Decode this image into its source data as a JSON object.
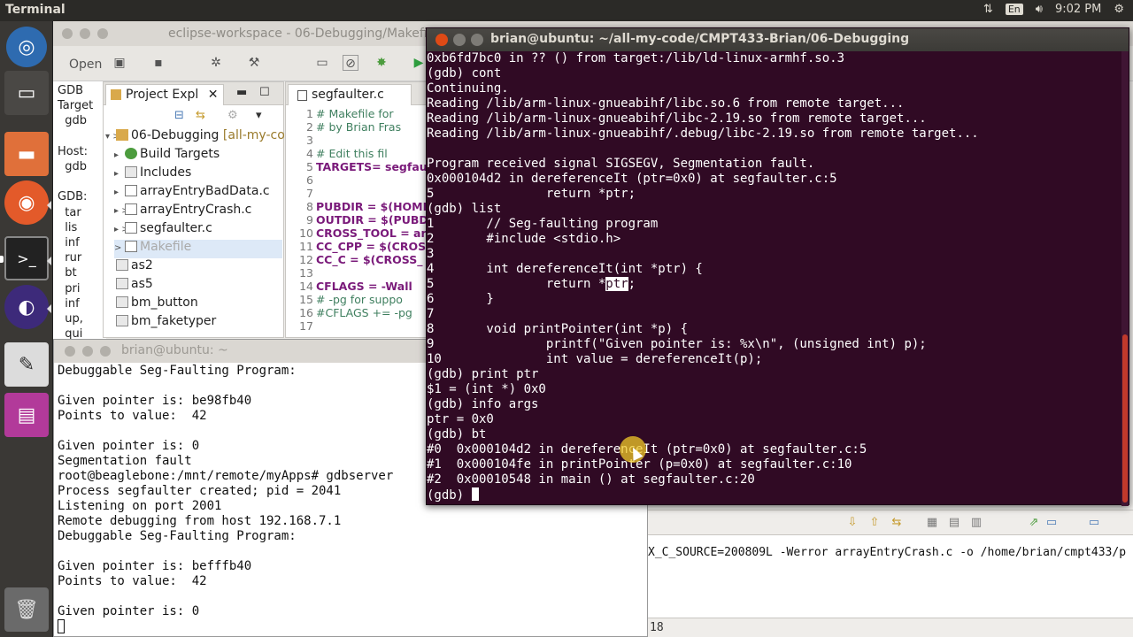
{
  "top_panel": {
    "app_title": "Terminal",
    "lang": "En",
    "time": "9:02 PM"
  },
  "eclipse": {
    "title": "eclipse-workspace - 06-Debugging/Makefi",
    "menu_open": "Open",
    "gdb_lines": [
      "GDB",
      "Target",
      "  gdb",
      "",
      "Host:",
      "  gdb",
      "",
      "GDB:",
      "  tar",
      "  lis",
      "  inf",
      "  rur",
      "  bt",
      "  pri",
      "  inf",
      "  up,",
      "  qui"
    ],
    "project_explorer": {
      "tab_label": "Project Expl",
      "items": [
        {
          "label": "06-Debugging",
          "suffix": "[all-my-co",
          "arrow": "▾ >",
          "icon": "proj",
          "indent": 0
        },
        {
          "label": "Build Targets",
          "arrow": "▸",
          "icon": "green",
          "indent": 1
        },
        {
          "label": "Includes",
          "arrow": "▸",
          "icon": "folder",
          "indent": 1
        },
        {
          "label": "arrayEntryBadData.c",
          "arrow": "▸",
          "icon": "file",
          "indent": 1
        },
        {
          "label": "arrayEntryCrash.c",
          "arrow": "▸ >",
          "icon": "file",
          "indent": 1
        },
        {
          "label": "segfaulter.c",
          "arrow": "▸ >",
          "icon": "file",
          "indent": 1
        },
        {
          "label": "Makefile",
          "arrow": " >",
          "icon": "file",
          "indent": 1,
          "selected": true
        },
        {
          "label": "as2",
          "arrow": "",
          "icon": "folder",
          "indent": 0
        },
        {
          "label": "as5",
          "arrow": "",
          "icon": "folder",
          "indent": 0
        },
        {
          "label": "bm_button",
          "arrow": "",
          "icon": "folder",
          "indent": 0
        },
        {
          "label": "bm_faketyper",
          "arrow": "",
          "icon": "folder",
          "indent": 0
        }
      ]
    },
    "editor": {
      "tab_label": "segfaulter.c",
      "lines": [
        {
          "n": "1",
          "text": "# Makefile for",
          "cls": "c-comment"
        },
        {
          "n": "2",
          "text": "# by Brian Fras",
          "cls": "c-comment"
        },
        {
          "n": "3",
          "text": "",
          "cls": ""
        },
        {
          "n": "4",
          "text": "# Edit this fil",
          "cls": "c-comment"
        },
        {
          "n": "5",
          "text": "TARGETS= segfau",
          "cls": "c-var"
        },
        {
          "n": "6",
          "text": "",
          "cls": ""
        },
        {
          "n": "7",
          "text": "",
          "cls": ""
        },
        {
          "n": "8",
          "text": "PUBDIR = $(HOME",
          "cls": "c-var"
        },
        {
          "n": "9",
          "text": "OUTDIR = $(PUBD",
          "cls": "c-var"
        },
        {
          "n": "10",
          "text": "CROSS_TOOL = ar",
          "cls": "c-var"
        },
        {
          "n": "11",
          "text": "CC_CPP = $(CROS",
          "cls": "c-var"
        },
        {
          "n": "12",
          "text": "CC_C = $(CROSS_",
          "cls": "c-var"
        },
        {
          "n": "13",
          "text": "",
          "cls": ""
        },
        {
          "n": "14",
          "text": "CFLAGS = -Wall",
          "cls": "c-var"
        },
        {
          "n": "15",
          "text": "# -pg for suppo",
          "cls": "c-comment"
        },
        {
          "n": "16",
          "text": "#CFLAGS += -pg",
          "cls": "c-comment"
        },
        {
          "n": "17",
          "text": "",
          "cls": ""
        }
      ]
    },
    "console_text": "X_C_SOURCE=200809L -Werror arrayEntryCrash.c -o /home/brian/cmpt433/p",
    "status_text": "18"
  },
  "term2": {
    "title": "brian@ubuntu: ~",
    "lines": [
      "Debuggable Seg-Faulting Program:",
      "",
      "Given pointer is: be98fb40",
      "Points to value:  42",
      "",
      "Given pointer is: 0",
      "Segmentation fault",
      "root@beaglebone:/mnt/remote/myApps# gdbserver",
      "Process segfaulter created; pid = 2041",
      "Listening on port 2001",
      "Remote debugging from host 192.168.7.1",
      "Debuggable Seg-Faulting Program:",
      "",
      "Given pointer is: befffb40",
      "Points to value:  42",
      "",
      "Given pointer is: 0"
    ]
  },
  "term1": {
    "title": "brian@ubuntu: ~/all-my-code/CMPT433-Brian/06-Debugging",
    "lines_before": [
      "0xb6fd7bc0 in ?? () from target:/lib/ld-linux-armhf.so.3",
      "(gdb) cont",
      "Continuing.",
      "Reading /lib/arm-linux-gnueabihf/libc.so.6 from remote target...",
      "Reading /lib/arm-linux-gnueabihf/libc-2.19.so from remote target...",
      "Reading /lib/arm-linux-gnueabihf/.debug/libc-2.19.so from remote target...",
      "",
      "Program received signal SIGSEGV, Segmentation fault.",
      "0x000104d2 in dereferenceIt (ptr=0x0) at segfaulter.c:5",
      "5\t\treturn *ptr;",
      "(gdb) list",
      "1\t// Seg-faulting program",
      "2\t#include <stdio.h>",
      "3",
      "4\tint dereferenceIt(int *ptr) {"
    ],
    "hl_prefix": "5\t\treturn *",
    "hl_word": "ptr",
    "hl_suffix": ";",
    "lines_after": [
      "6\t}",
      "7",
      "8\tvoid printPointer(int *p) {",
      "9\t\tprintf(\"Given pointer is: %x\\n\", (unsigned int) p);",
      "10\t\tint value = dereferenceIt(p);",
      "(gdb) print ptr",
      "$1 = (int *) 0x0",
      "(gdb) info args",
      "ptr = 0x0",
      "(gdb) bt",
      "#0  0x000104d2 in dereferenceIt (ptr=0x0) at segfaulter.c:5",
      "#1  0x000104fe in printPointer (p=0x0) at segfaulter.c:10",
      "#2  0x00010548 in main () at segfaulter.c:20"
    ],
    "prompt": "(gdb) "
  },
  "colors": {
    "terminal_bg": "#300a24",
    "close_btn": "#df4a16",
    "panel_bg": "#2b2a27"
  }
}
